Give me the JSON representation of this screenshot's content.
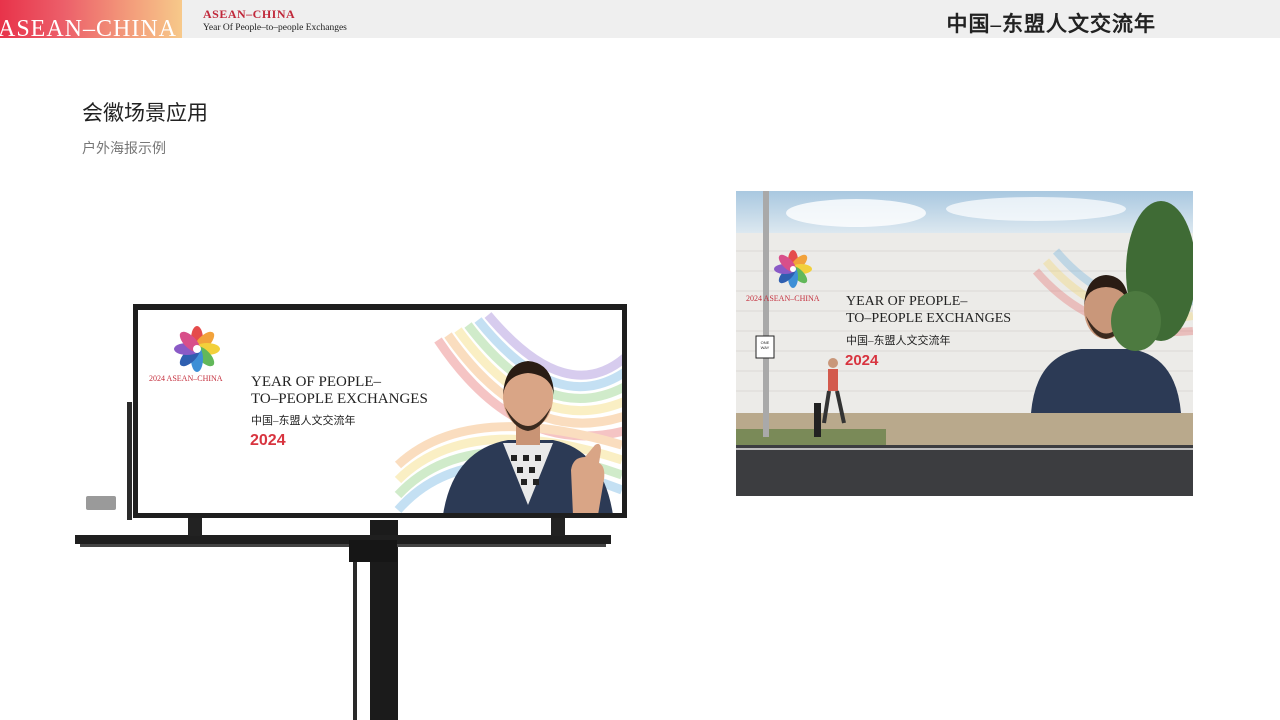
{
  "header": {
    "brand_block_text": "ASEAN–CHINA",
    "title": "ASEAN–CHINA",
    "subtitle": "Year Of People–to–people Exchanges",
    "chinese_title": "中国–东盟人文交流年"
  },
  "page": {
    "title": "会徽场景应用",
    "subtitle": "户外海报示例"
  },
  "billboard_ad": {
    "brand_line": "2024 ASEAN–CHINA",
    "headline_line1": "YEAR OF PEOPLE–",
    "headline_line2": "TO–PEOPLE EXCHANGES",
    "chinese": "中国–东盟人文交流年",
    "year": "2024"
  },
  "wall_ad": {
    "brand_line": "2024 ASEAN–CHINA",
    "headline_line1": "YEAR OF PEOPLE–",
    "headline_line2": "TO–PEOPLE EXCHANGES",
    "chinese": "中国–东盟人文交流年",
    "year": "2024",
    "sign_text": "ONE WAY"
  },
  "colors": {
    "brand_red": "#c42f3d",
    "gradient_start": "#e8334a",
    "gradient_end": "#f7c98a"
  }
}
